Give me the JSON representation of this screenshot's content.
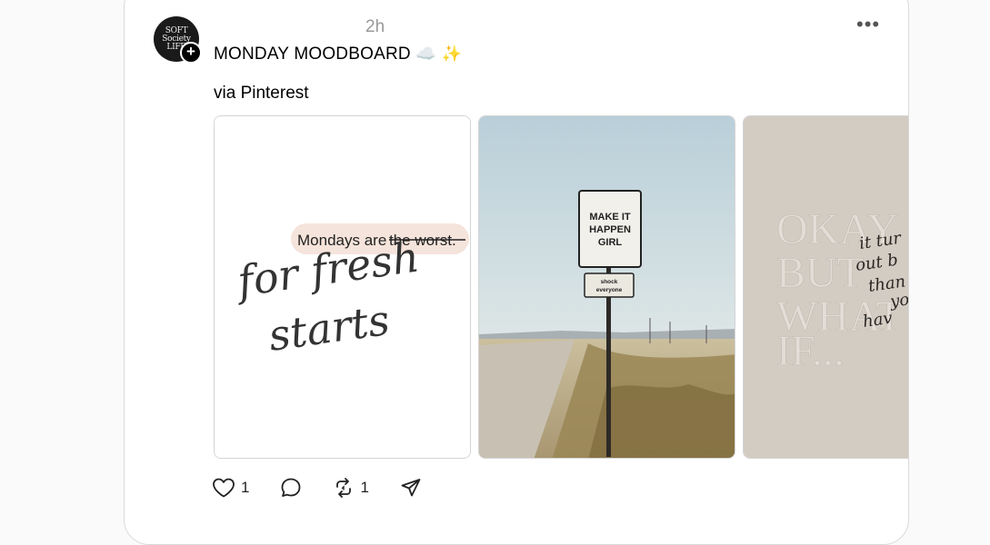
{
  "post": {
    "avatar_text": "SOFT\nSociety\nLIFE",
    "timestamp": "2h",
    "title": "MONDAY MOODBOARD",
    "title_emoji": "☁️ ✨",
    "subtitle": "via Pinterest",
    "images": [
      {
        "name": "mondays-quote-image",
        "highlight_text": "Mondays are",
        "struck_text": "the worst.",
        "script_text_line1": "for fresh",
        "script_text_line2": "starts"
      },
      {
        "name": "road-sign-image",
        "sign_line1": "MAKE IT",
        "sign_line2": "HAPPEN",
        "sign_line3": "GIRL",
        "small_sign_line1": "shock",
        "small_sign_line2": "everyone"
      },
      {
        "name": "okay-but-what-if-image",
        "emboss_line1": "OKAY",
        "emboss_line2": "BUT",
        "emboss_line3": "WHAT",
        "emboss_line4": "IF...",
        "script_line1": "it tur",
        "script_line2": "out b",
        "script_line3": "than",
        "script_line4": "yo",
        "script_line5": "hav"
      }
    ],
    "actions": {
      "like_count": "1",
      "repost_count": "1"
    }
  },
  "icons": {
    "more": "more-horizontal-icon",
    "like": "heart-icon",
    "comment": "comment-icon",
    "repost": "repost-icon",
    "share": "send-icon"
  }
}
